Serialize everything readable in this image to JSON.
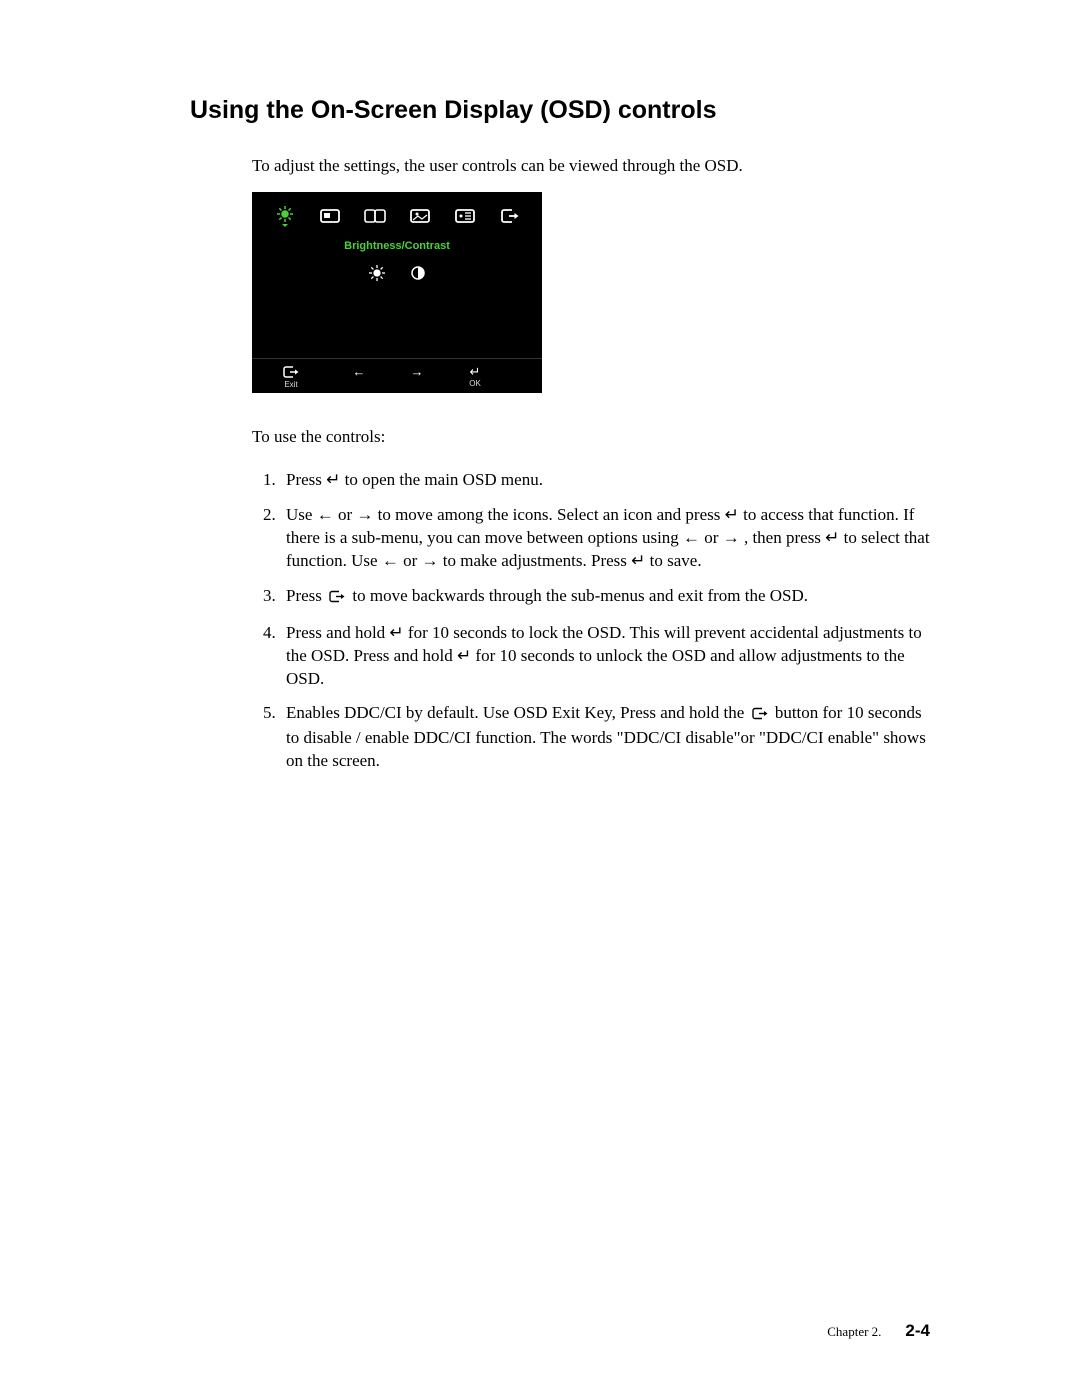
{
  "heading": "Using the On-Screen Display (OSD) controls",
  "intro": "To adjust the settings, the user controls can be viewed through the OSD.",
  "osd": {
    "top_icons": [
      "brightness-icon",
      "position-icon",
      "image-icon",
      "options-icon",
      "menu-icon",
      "exit-icon"
    ],
    "selected_label": "Brightness/Contrast",
    "sub_icons": [
      "sun-icon",
      "contrast-icon"
    ],
    "nav": {
      "exit_label": "Exit",
      "ok_label": "OK"
    }
  },
  "to_use": "To use the controls:",
  "steps": {
    "s1": "Press ↵ to open the main OSD menu.",
    "s2": "Use ← or → to move among the icons. Select an icon and press ↵ to access that function. If there is a sub-menu, you can move between options using ← or → , then press ↵ to select that function. Use ← or → to make adjustments. Press ↵ to save.",
    "s3_a": "Press ",
    "s3_b": " to move backwards through the sub-menus and exit from the OSD.",
    "s4": "Press and hold ↵ for 10 seconds to lock the OSD. This will prevent accidental adjustments to the OSD. Press and hold ↵ for 10  seconds to unlock the OSD and allow adjustments to the OSD.",
    "s5_a": "Enables DDC/CI by default. Use OSD Exit Key, Press and hold the ",
    "s5_b": " button for 10 seconds to disable / enable DDC/CI function. The words \"DDC/CI disable\"or \"DDC/CI enable\" shows on the screen."
  },
  "footer": {
    "chapter": "Chapter 2.",
    "page": "2-4"
  }
}
